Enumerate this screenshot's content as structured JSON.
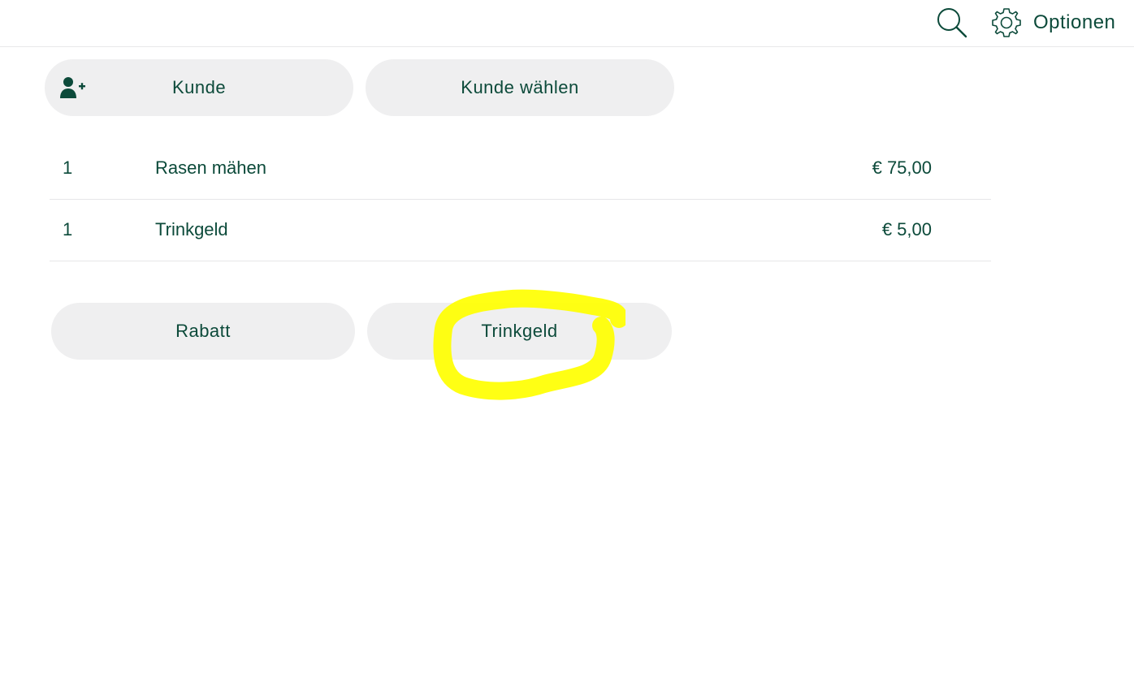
{
  "header": {
    "options_label": "Optionen",
    "search_icon": "search-icon",
    "options_icon": "gear-icon"
  },
  "customer": {
    "add_label": "Kunde",
    "choose_label": "Kunde wählen",
    "add_icon": "add-person-icon"
  },
  "items": [
    {
      "qty": "1",
      "name": "Rasen mähen",
      "price": "€ 75,00"
    },
    {
      "qty": "1",
      "name": "Trinkgeld",
      "price": "€ 5,00"
    }
  ],
  "actions": {
    "discount_label": "Rabatt",
    "tip_label": "Trinkgeld"
  },
  "colors": {
    "text": "#0c4a3a",
    "pill_bg": "#efeff0",
    "highlight": "#ffff00"
  }
}
